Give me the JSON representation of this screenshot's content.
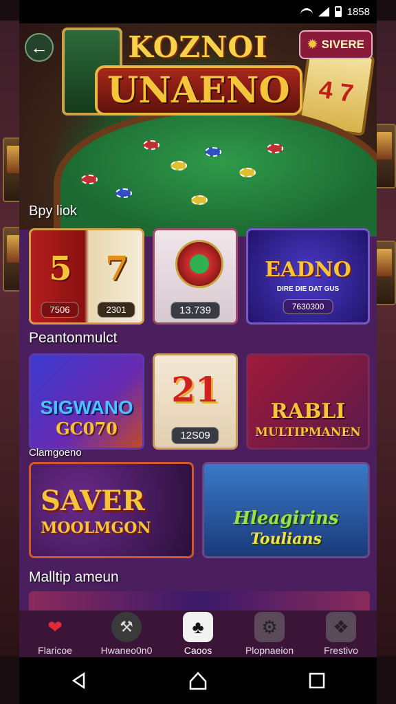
{
  "status_bar": {
    "time": "1858"
  },
  "header": {
    "logo_line1": "KOZNOI",
    "logo_line2": "UNAENO",
    "badge_label": "SIVERE"
  },
  "hero": {
    "caption": "Bpy liok"
  },
  "sections": {
    "section1_title": "Peantonmulct",
    "section2_title": "Clamgoeno",
    "section3_title": "Malltip ameun"
  },
  "cards": {
    "slot": {
      "left_num": "5",
      "right_num": "7",
      "left_value": "7506",
      "right_value": "2301"
    },
    "timer": {
      "value": "13.739"
    },
    "feature": {
      "title": "EADNO",
      "subtitle": "DIRE DIE DAT GUS",
      "value": "7630300"
    },
    "hero_a": {
      "title": "SIGWANO",
      "subtitle": "GC070"
    },
    "num": {
      "big": "21",
      "value": "12S09"
    },
    "multi": {
      "title": "RABLI",
      "subtitle": "MULTIPMANEN"
    },
    "saver": {
      "title": "SAVER",
      "subtitle": "MOOLMGON"
    },
    "people": {
      "title": "Hleagirins",
      "subtitle": "Toulians"
    }
  },
  "tabs": [
    {
      "label": "Flaricoe",
      "icon": "heart-icon"
    },
    {
      "label": "Hwaneo0n0",
      "icon": "wrench-icon"
    },
    {
      "label": "Caoos",
      "icon": "club-card-icon"
    },
    {
      "label": "Plopnaeion",
      "icon": "gear-icon"
    },
    {
      "label": "Frestivo",
      "icon": "puzzle-icon"
    }
  ],
  "colors": {
    "app_bg": "#4b1f5e",
    "tab_bar": "#3a1538",
    "accent_gold": "#f4c43a",
    "accent_red": "#d0202a"
  }
}
